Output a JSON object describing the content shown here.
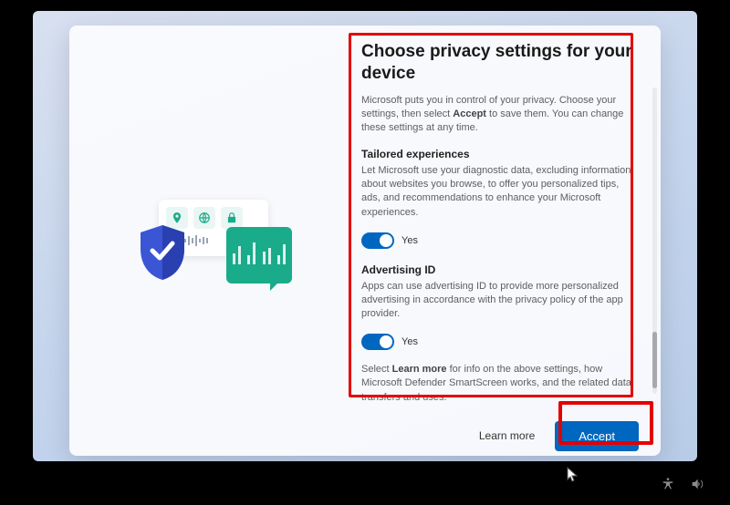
{
  "title": "Choose privacy settings for your device",
  "intro_parts": {
    "pre": "Microsoft puts you in control of your privacy. Choose your settings, then select ",
    "bold": "Accept",
    "post": " to save them. You can change these settings at any time."
  },
  "sections": [
    {
      "title": "Tailored experiences",
      "desc": "Let Microsoft use your diagnostic data, excluding information about websites you browse, to offer you personalized tips, ads, and recommendations to enhance your Microsoft experiences.",
      "toggle_on": true,
      "toggle_label": "Yes"
    },
    {
      "title": "Advertising ID",
      "desc": "Apps can use advertising ID to provide more personalized advertising in accordance with the privacy policy of the app provider.",
      "toggle_on": true,
      "toggle_label": "Yes"
    }
  ],
  "footer_parts": {
    "pre": "Select ",
    "bold": "Learn more",
    "post": " for info on the above settings, how Microsoft Defender SmartScreen works, and the related data transfers and uses."
  },
  "buttons": {
    "learn_more": "Learn more",
    "accept": "Accept"
  },
  "tray": {
    "accessibility": "accessibility-icon",
    "volume": "volume-icon"
  },
  "colors": {
    "accent": "#0067c0",
    "highlight": "#e40000"
  }
}
